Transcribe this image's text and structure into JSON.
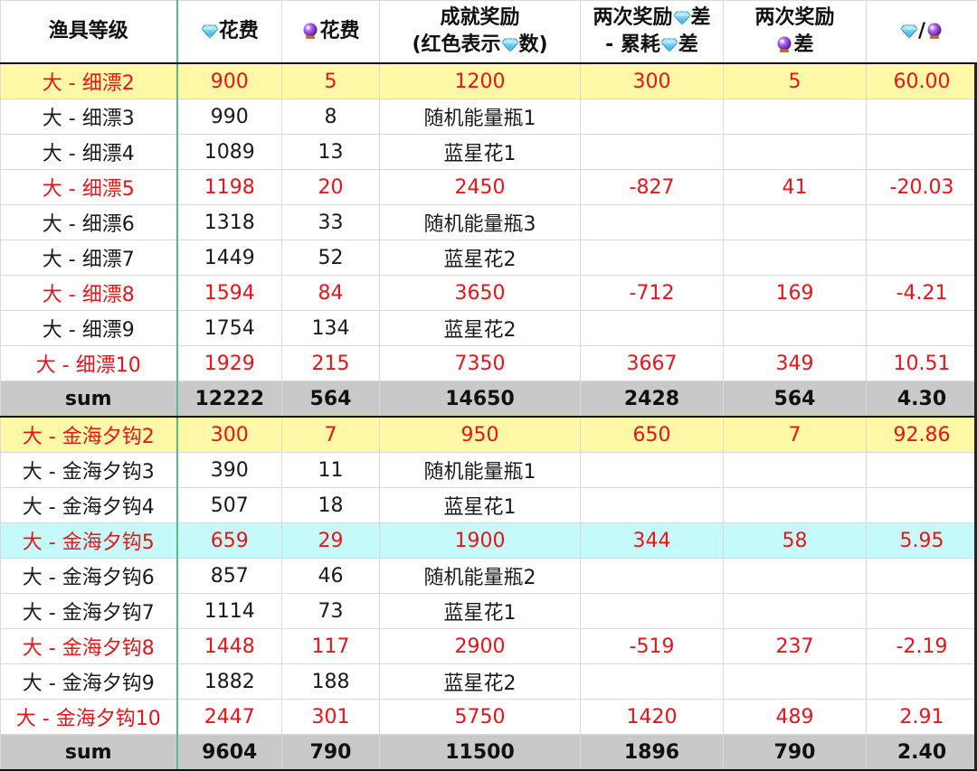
{
  "header": {
    "col0": "渔具等级",
    "col1": "花费",
    "col2": "花费",
    "col3_line1": "成就奖励",
    "col3_line2_a": "(红色表示",
    "col3_line2_b": "数)",
    "col4_line1_a": "两次奖励",
    "col4_line1_b": "差",
    "col4_line2_a": "- 累耗",
    "col4_line2_b": "差",
    "col5_line1": "两次奖励",
    "col5_line2": "差",
    "col6_sep": "/"
  },
  "icons": {
    "diamond": "diamond-icon",
    "crystal_ball": "crystal-ball-icon"
  },
  "colors": {
    "highlight_text": "#e8141a",
    "first_row_bg": "#fff8a6",
    "cyan_row_bg": "#c6fafa",
    "sum_bg": "#c9c9c9"
  },
  "groups": [
    {
      "rows": [
        {
          "name": "大 - 细漂2",
          "diamond": "900",
          "orb": "5",
          "reward": "1200",
          "diff": "300",
          "orb_diff": "5",
          "ratio": "60.00",
          "style": "hl first"
        },
        {
          "name": "大 - 细漂3",
          "diamond": "990",
          "orb": "8",
          "reward": "随机能量瓶1",
          "diff": "",
          "orb_diff": "",
          "ratio": "",
          "style": ""
        },
        {
          "name": "大 - 细漂4",
          "diamond": "1089",
          "orb": "13",
          "reward": "蓝星花1",
          "diff": "",
          "orb_diff": "",
          "ratio": "",
          "style": ""
        },
        {
          "name": "大 - 细漂5",
          "diamond": "1198",
          "orb": "20",
          "reward": "2450",
          "diff": "-827",
          "orb_diff": "41",
          "ratio": "-20.03",
          "style": "hl"
        },
        {
          "name": "大 - 细漂6",
          "diamond": "1318",
          "orb": "33",
          "reward": "随机能量瓶3",
          "diff": "",
          "orb_diff": "",
          "ratio": "",
          "style": ""
        },
        {
          "name": "大 - 细漂7",
          "diamond": "1449",
          "orb": "52",
          "reward": "蓝星花2",
          "diff": "",
          "orb_diff": "",
          "ratio": "",
          "style": ""
        },
        {
          "name": "大 - 细漂8",
          "diamond": "1594",
          "orb": "84",
          "reward": "3650",
          "diff": "-712",
          "orb_diff": "169",
          "ratio": "-4.21",
          "style": "hl"
        },
        {
          "name": "大 - 细漂9",
          "diamond": "1754",
          "orb": "134",
          "reward": "蓝星花2",
          "diff": "",
          "orb_diff": "",
          "ratio": "",
          "style": ""
        },
        {
          "name": "大 - 细漂10",
          "diamond": "1929",
          "orb": "215",
          "reward": "7350",
          "diff": "3667",
          "orb_diff": "349",
          "ratio": "10.51",
          "style": "hl"
        }
      ],
      "sum": {
        "name": "sum",
        "diamond": "12222",
        "orb": "564",
        "reward": "14650",
        "diff": "2428",
        "orb_diff": "564",
        "ratio": "4.30"
      }
    },
    {
      "rows": [
        {
          "name": "大 - 金海夕钩2",
          "diamond": "300",
          "orb": "7",
          "reward": "950",
          "diff": "650",
          "orb_diff": "7",
          "ratio": "92.86",
          "style": "hl first"
        },
        {
          "name": "大 - 金海夕钩3",
          "diamond": "390",
          "orb": "11",
          "reward": "随机能量瓶1",
          "diff": "",
          "orb_diff": "",
          "ratio": "",
          "style": ""
        },
        {
          "name": "大 - 金海夕钩4",
          "diamond": "507",
          "orb": "18",
          "reward": "蓝星花1",
          "diff": "",
          "orb_diff": "",
          "ratio": "",
          "style": ""
        },
        {
          "name": "大 - 金海夕钩5",
          "diamond": "659",
          "orb": "29",
          "reward": "1900",
          "diff": "344",
          "orb_diff": "58",
          "ratio": "5.95",
          "style": "hl cyan"
        },
        {
          "name": "大 - 金海夕钩6",
          "diamond": "857",
          "orb": "46",
          "reward": "随机能量瓶2",
          "diff": "",
          "orb_diff": "",
          "ratio": "",
          "style": ""
        },
        {
          "name": "大 - 金海夕钩7",
          "diamond": "1114",
          "orb": "73",
          "reward": "蓝星花1",
          "diff": "",
          "orb_diff": "",
          "ratio": "",
          "style": ""
        },
        {
          "name": "大 - 金海夕钩8",
          "diamond": "1448",
          "orb": "117",
          "reward": "2900",
          "diff": "-519",
          "orb_diff": "237",
          "ratio": "-2.19",
          "style": "hl"
        },
        {
          "name": "大 - 金海夕钩9",
          "diamond": "1882",
          "orb": "188",
          "reward": "蓝星花2",
          "diff": "",
          "orb_diff": "",
          "ratio": "",
          "style": ""
        },
        {
          "name": "大 - 金海夕钩10",
          "diamond": "2447",
          "orb": "301",
          "reward": "5750",
          "diff": "1420",
          "orb_diff": "489",
          "ratio": "2.91",
          "style": "hl"
        }
      ],
      "sum": {
        "name": "sum",
        "diamond": "9604",
        "orb": "790",
        "reward": "11500",
        "diff": "1896",
        "orb_diff": "790",
        "ratio": "2.40"
      }
    }
  ]
}
